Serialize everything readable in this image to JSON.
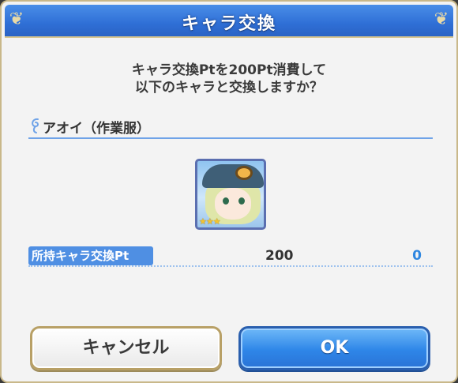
{
  "dialog": {
    "title": "キャラ交換",
    "message_line1": "キャラ交換Ptを200Pt消費して",
    "message_line2": "以下のキャラと交換しますか？",
    "character_name": "アオイ（作業服）",
    "stars": "★★★",
    "points_label": "所持キャラ交換Pt",
    "cost_value": "200",
    "owned_value": "0",
    "cancel_label": "キャンセル",
    "ok_label": "OK"
  },
  "colors": {
    "header_blue": "#2f6fd6",
    "accent_blue": "#4f8fe3",
    "ok_blue": "#2e86e8",
    "owned_value_blue": "#2e86e0",
    "gold_border": "#b8a066"
  },
  "icons": {
    "header_corner_left": "ornament-icon",
    "header_corner_right": "ornament-icon",
    "section_marker": "swirl-icon",
    "character_portrait": "character-portrait"
  }
}
